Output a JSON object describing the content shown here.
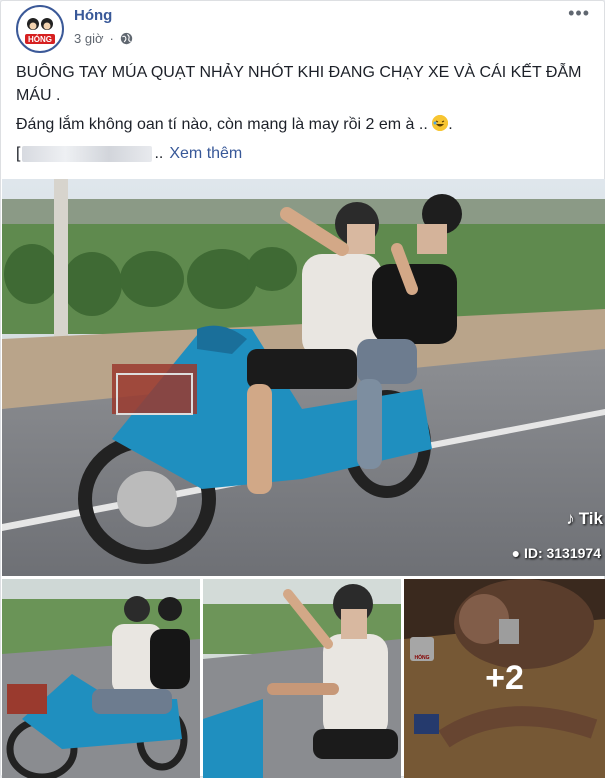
{
  "post": {
    "author": "Hóng",
    "time": "3 giờ",
    "caption_line1": "BUÔNG TAY MÚA QUẠT NHẢY NHÓT KHI ĐANG CHẠY XE VÀ CÁI KẾT ĐẪM MÁU .",
    "caption_line2": "Đáng lắm không oan tí nào, còn mạng là may rồi 2 em à ..",
    "caption_line3_prefix": "[",
    "caption_line3_suffix": "..",
    "see_more": "Xem thêm",
    "more_count": "+2"
  },
  "video": {
    "watermark": "Tik",
    "id_label": "ID: 3131974"
  },
  "icons": [
    "globe-icon",
    "more-options-icon",
    "laughing-emoji-icon",
    "tiktok-icon",
    "user-icon"
  ],
  "colors": {
    "link": "#385898",
    "text": "#1d2129",
    "muted": "#606770"
  }
}
